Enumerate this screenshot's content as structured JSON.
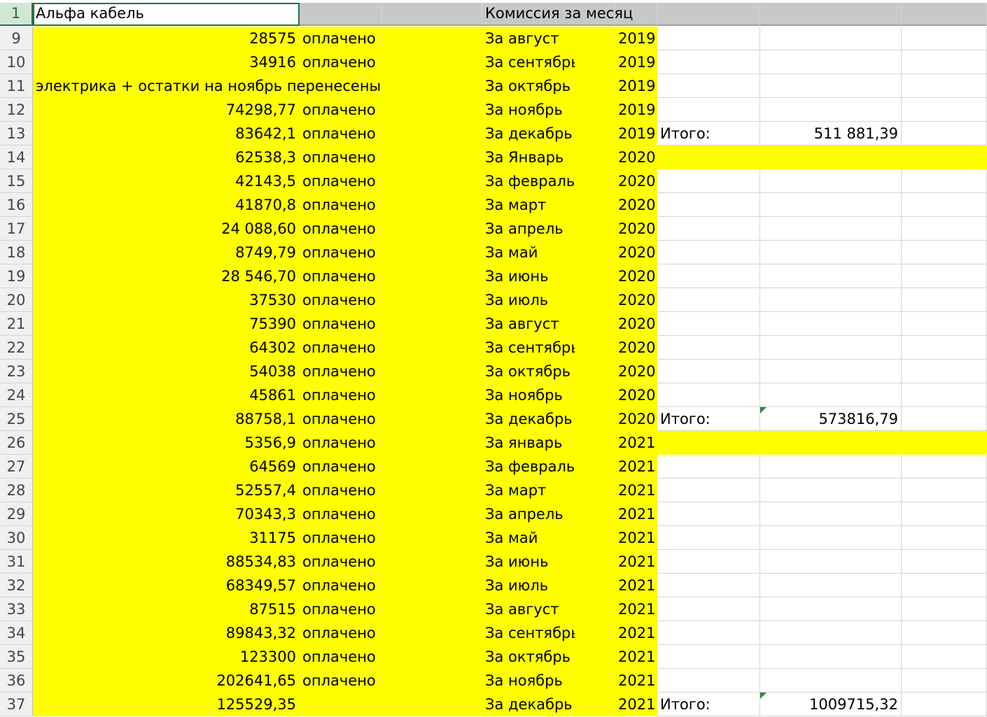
{
  "header_row": {
    "row_number": "1",
    "a1_value": "Альфа кабель",
    "d1_value": "Комиссия за месяц"
  },
  "rows": [
    {
      "num": "9",
      "a": "28575",
      "b": "оплачено",
      "d": "За август",
      "e": "2019",
      "f": "",
      "g": ""
    },
    {
      "num": "10",
      "a": "34916",
      "b": "оплачено",
      "d": "За сентябрь",
      "e": "2019",
      "f": "",
      "g": ""
    },
    {
      "num": "11",
      "a": "электрика + остатки на ноябрь перенесены",
      "b": "",
      "d": "За октябрь",
      "e": "2019",
      "f": "",
      "g": ""
    },
    {
      "num": "12",
      "a": "74298,77",
      "b": "оплачено",
      "d": "За ноябрь",
      "e": "2019",
      "f": "",
      "g": ""
    },
    {
      "num": "13",
      "a": "83642,1",
      "b": "оплачено",
      "d": "За декабрь",
      "e": "2019",
      "f": "Итого:",
      "g": "511 881,39"
    },
    {
      "num": "14",
      "a": "62538,3",
      "b": "оплачено",
      "d": "За Январь",
      "e": "2020",
      "f": "",
      "g": ""
    },
    {
      "num": "15",
      "a": "42143,5",
      "b": "оплачено",
      "d": "За февраль",
      "e": "2020",
      "f": "",
      "g": ""
    },
    {
      "num": "16",
      "a": "41870,8",
      "b": "оплачено",
      "d": "За март",
      "e": "2020",
      "f": "",
      "g": ""
    },
    {
      "num": "17",
      "a": "24 088,60",
      "b": "оплачено",
      "d": "За апрель",
      "e": "2020",
      "f": "",
      "g": ""
    },
    {
      "num": "18",
      "a": "8749,79",
      "b": "оплачено",
      "d": "За май",
      "e": "2020",
      "f": "",
      "g": ""
    },
    {
      "num": "19",
      "a": "28 546,70",
      "b": "оплачено",
      "d": "За июнь",
      "e": "2020",
      "f": "",
      "g": ""
    },
    {
      "num": "20",
      "a": "37530",
      "b": "оплачено",
      "d": "За июль",
      "e": "2020",
      "f": "",
      "g": ""
    },
    {
      "num": "21",
      "a": "75390",
      "b": "оплачено",
      "d": "За август",
      "e": "2020",
      "f": "",
      "g": ""
    },
    {
      "num": "22",
      "a": "64302",
      "b": "оплачено",
      "d": "За сентябрь",
      "e": "2020",
      "f": "",
      "g": ""
    },
    {
      "num": "23",
      "a": "54038",
      "b": "оплачено",
      "d": "За октябрь",
      "e": "2020",
      "f": "",
      "g": ""
    },
    {
      "num": "24",
      "a": "45861",
      "b": "оплачено",
      "d": "За ноябрь",
      "e": "2020",
      "f": "",
      "g": ""
    },
    {
      "num": "25",
      "a": "88758,1",
      "b": "оплачено",
      "d": "За декабрь",
      "e": "2020",
      "f": "Итого:",
      "g": "573816,79"
    },
    {
      "num": "26",
      "a": "5356,9",
      "b": "оплачено",
      "d": "За январь",
      "e": "2021",
      "f": "",
      "g": ""
    },
    {
      "num": "27",
      "a": "64569",
      "b": "оплачено",
      "d": "За февраль",
      "e": "2021",
      "f": "",
      "g": ""
    },
    {
      "num": "28",
      "a": "52557,4",
      "b": "оплачено",
      "d": "За март",
      "e": "2021",
      "f": "",
      "g": ""
    },
    {
      "num": "29",
      "a": "70343,3",
      "b": "оплачено",
      "d": "За апрель",
      "e": "2021",
      "f": "",
      "g": ""
    },
    {
      "num": "30",
      "a": "31175",
      "b": "оплачено",
      "d": "За май",
      "e": "2021",
      "f": "",
      "g": ""
    },
    {
      "num": "31",
      "a": "88534,83",
      "b": "оплачено",
      "d": "За июнь",
      "e": "2021",
      "f": "",
      "g": ""
    },
    {
      "num": "32",
      "a": "68349,57",
      "b": "оплачено",
      "d": "За июль",
      "e": "2021",
      "f": "",
      "g": ""
    },
    {
      "num": "33",
      "a": "87515",
      "b": "оплачено",
      "d": "За август",
      "e": "2021",
      "f": "",
      "g": ""
    },
    {
      "num": "34",
      "a": "89843,32",
      "b": "оплачено",
      "d": "За сентябрь",
      "e": "2021",
      "f": "",
      "g": ""
    },
    {
      "num": "35",
      "a": "123300",
      "b": "оплачено",
      "d": "За октябрь",
      "e": "2021",
      "f": "",
      "g": ""
    },
    {
      "num": "36",
      "a": "202641,65",
      "b": "оплачено",
      "d": "За ноябрь",
      "e": "2021",
      "f": "",
      "g": ""
    },
    {
      "num": "37",
      "a": "125529,35",
      "b": "",
      "d": "За декабрь",
      "e": "2021",
      "f": "Итого:",
      "g": "1009715,32"
    }
  ],
  "highlight_full_rows": [
    "14",
    "26"
  ],
  "comment_marker_rows": [
    "25",
    "37"
  ],
  "colors": {
    "fill": "#ffff00",
    "selection_accent": "#217346",
    "comment_marker": "#2e8b3a"
  }
}
